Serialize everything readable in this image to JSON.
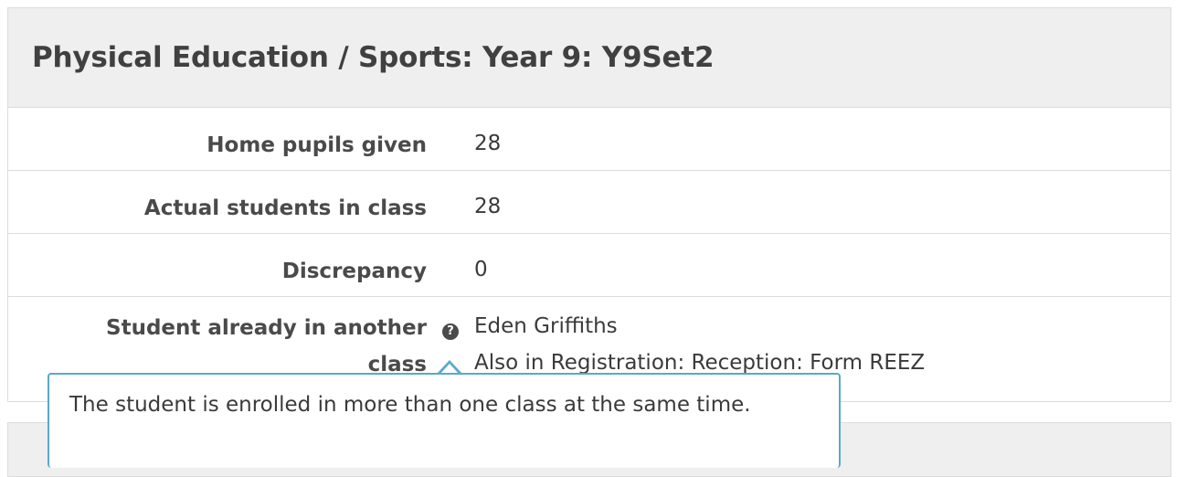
{
  "panel": {
    "title": "Physical Education / Sports: Year 9: Y9Set2",
    "rows": [
      {
        "label": "Home pupils given",
        "value": "28"
      },
      {
        "label": "Actual students in class",
        "value": "28"
      },
      {
        "label": "Discrepancy",
        "value": "0"
      },
      {
        "label": "Student already in another class",
        "value_line1": "Eden Griffiths",
        "value_line2": "Also in Registration: Reception: Form REEZ"
      }
    ]
  },
  "icons": {
    "help": "help-icon"
  },
  "tooltip": {
    "text": "The student is enrolled in more than one class at the same time."
  }
}
